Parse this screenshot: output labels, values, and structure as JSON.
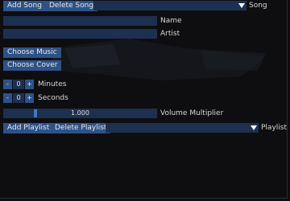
{
  "songs": {
    "add_label": "Add Song",
    "delete_label": "Delete Song",
    "select_label": "Song",
    "selected_value": ""
  },
  "song_fields": {
    "name_value": "",
    "name_label": "Name",
    "artist_value": "",
    "artist_label": "Artist"
  },
  "choose": {
    "music_label": "Choose Music",
    "cover_label": "Choose Cover"
  },
  "duration": {
    "minus": "-",
    "plus": "+",
    "minutes_value": "0",
    "minutes_label": "Minutes",
    "seconds_value": "0",
    "seconds_label": "Seconds"
  },
  "volume": {
    "value": 1.0,
    "display": "1.000",
    "label": "Volume Multiplier"
  },
  "playlists": {
    "add_label": "Add Playlist",
    "delete_label": "Delete Playlist",
    "select_label": "Playlist",
    "selected_value": ""
  },
  "colors": {
    "button": "#2d5287",
    "field": "#1d3050",
    "background": "#0e0e10"
  }
}
